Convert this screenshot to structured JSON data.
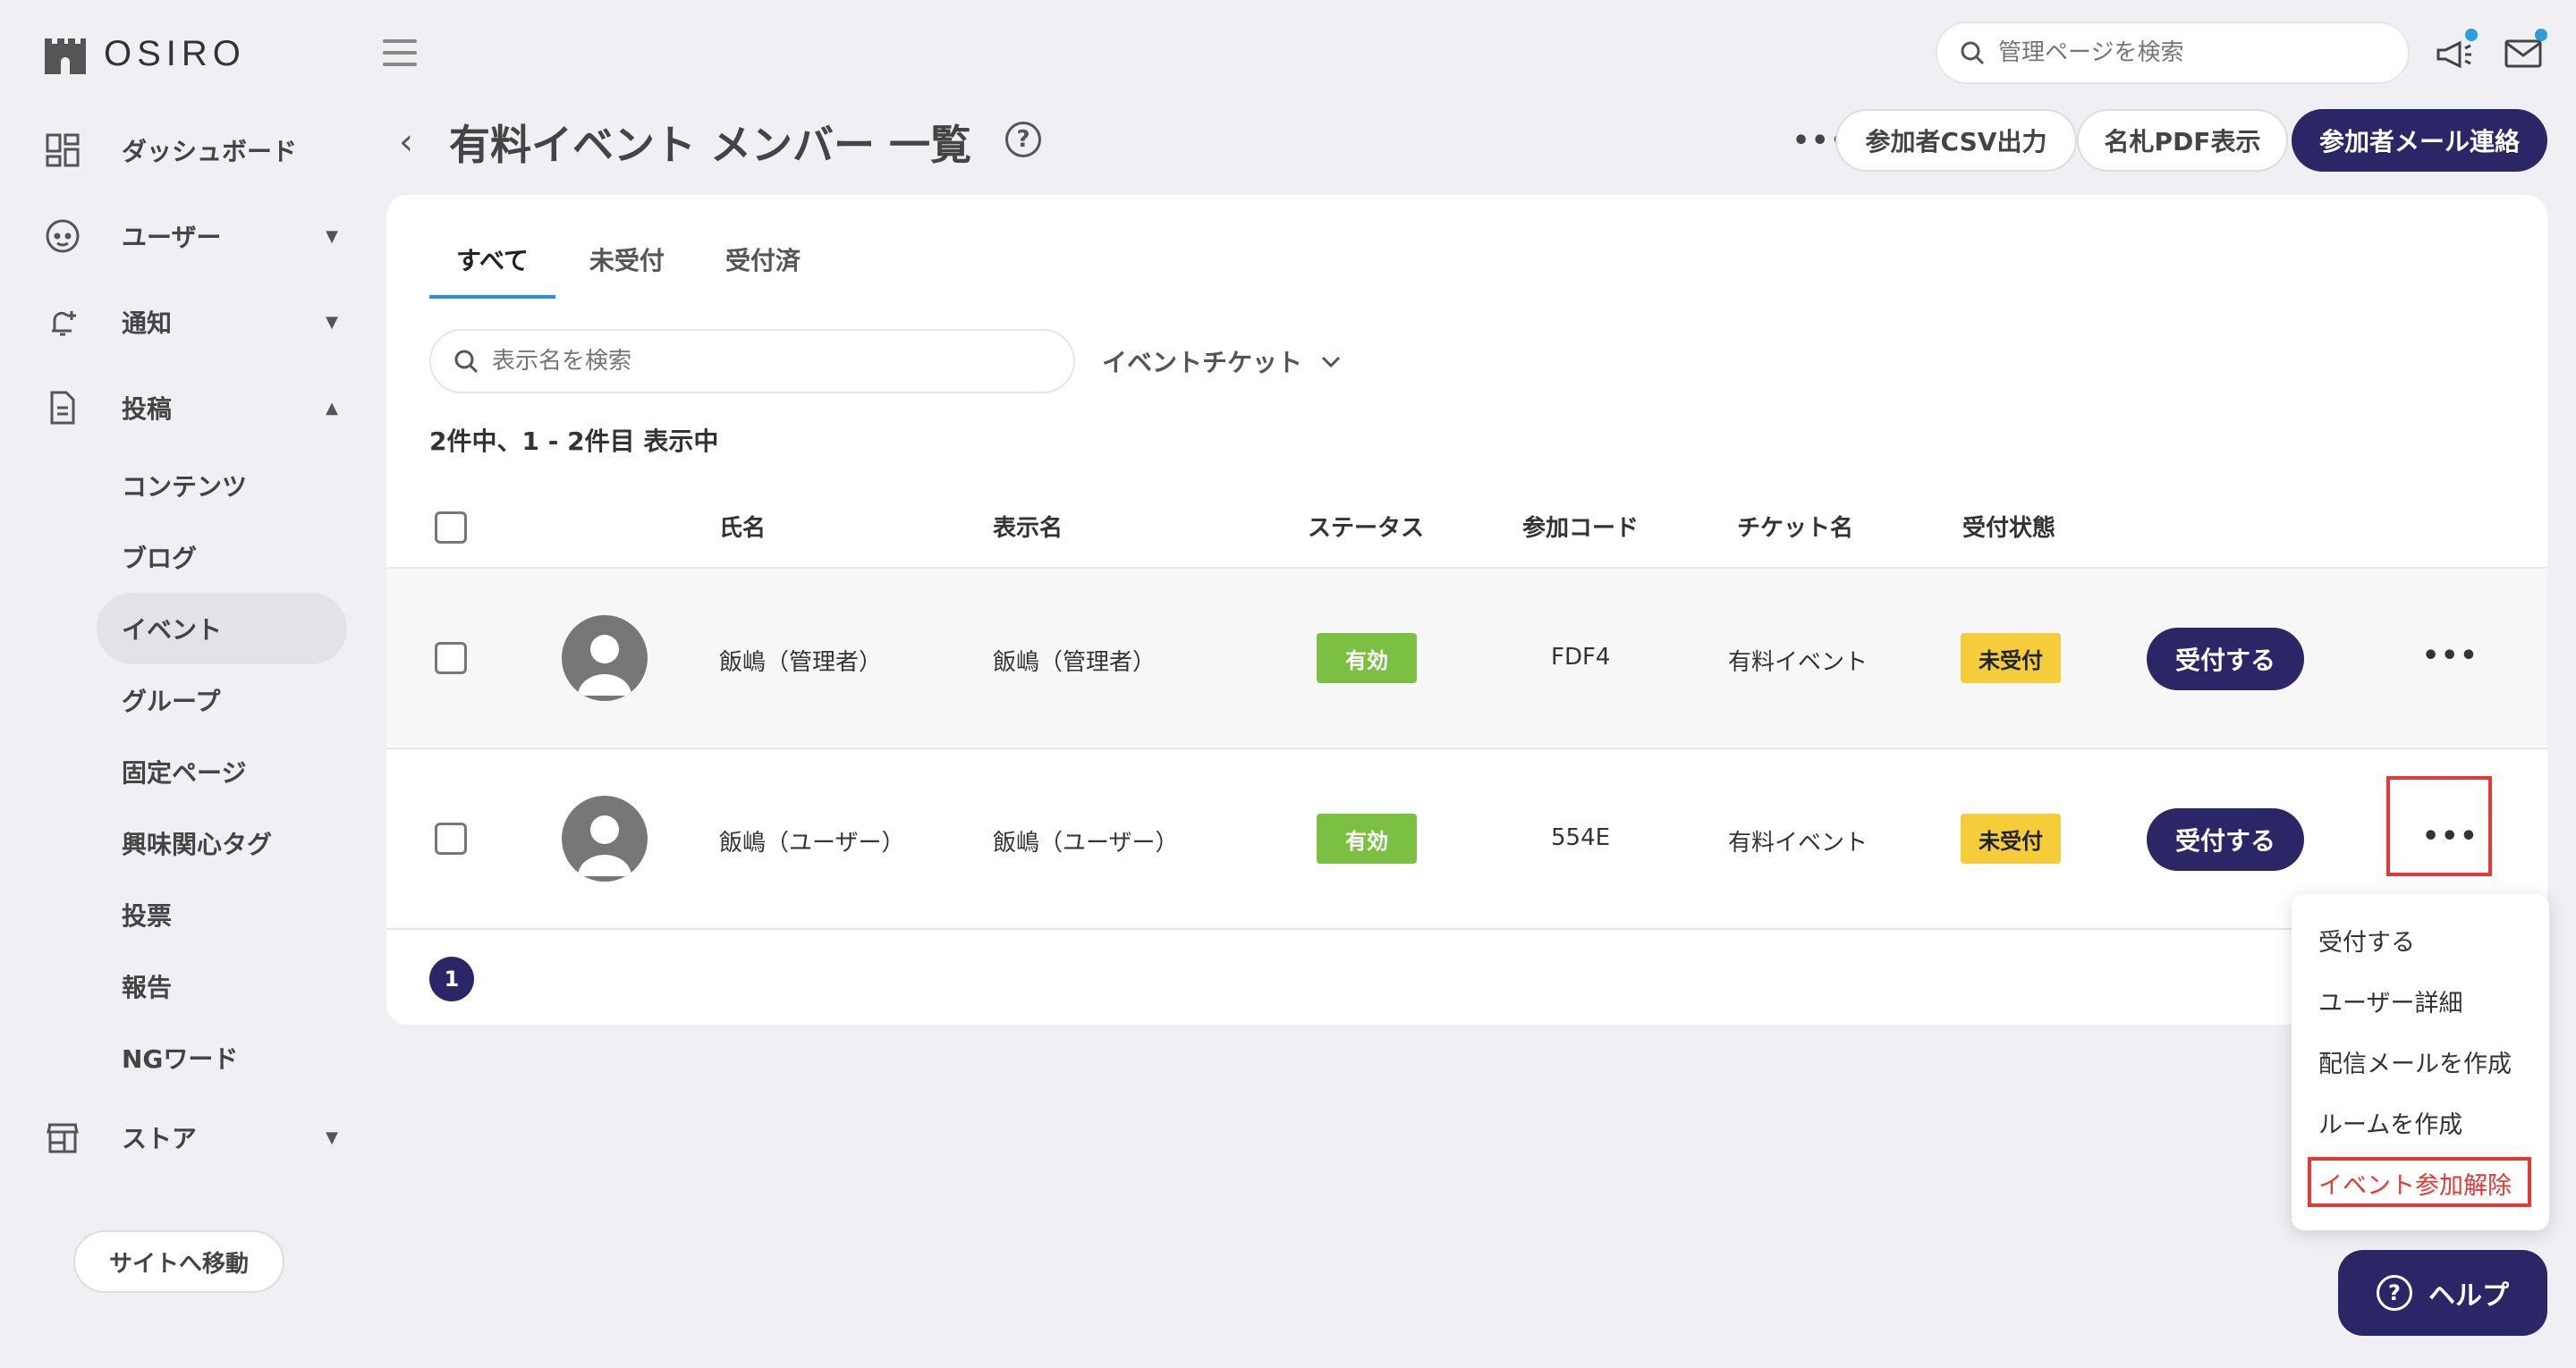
{
  "app": {
    "logo_text": "OSIRO"
  },
  "sidebar": {
    "items": [
      {
        "label": "ダッシュボード",
        "icon": "dashboard-icon"
      },
      {
        "label": "ユーザー",
        "icon": "user-face-icon",
        "caret": "▼"
      },
      {
        "label": "通知",
        "icon": "bell-plus-icon",
        "caret": "▼"
      },
      {
        "label": "投稿",
        "icon": "document-icon",
        "caret": "▲"
      },
      {
        "label": "ストア",
        "icon": "store-icon",
        "caret": "▼"
      }
    ],
    "sub_items": [
      "コンテンツ",
      "ブログ",
      "イベント",
      "グループ",
      "固定ページ",
      "興味関心タグ",
      "投票",
      "報告",
      "NGワード"
    ],
    "site_button": "サイトへ移動"
  },
  "header": {
    "search_placeholder": "管理ページを検索",
    "page_title": "有料イベント メンバー 一覧",
    "help_mark": "?",
    "more": "•••",
    "csv_button": "参加者CSV出力",
    "pdf_button": "名札PDF表示",
    "mail_button": "参加者メール連絡"
  },
  "tabs": [
    "すべて",
    "未受付",
    "受付済"
  ],
  "filters": {
    "search_placeholder": "表示名を検索",
    "ticket_filter": "イベントチケット"
  },
  "count_text": "2件中、1 - 2件目 表示中",
  "table": {
    "headers": [
      "氏名",
      "表示名",
      "ステータス",
      "参加コード",
      "チケット名",
      "受付状態"
    ],
    "rows": [
      {
        "name": "飯嶋（管理者）",
        "display": "飯嶋（管理者）",
        "status": "有効",
        "code": "FDF4",
        "ticket": "有料イベント",
        "reception": "未受付",
        "action": "受付する",
        "more": "•••"
      },
      {
        "name": "飯嶋（ユーザー）",
        "display": "飯嶋（ユーザー）",
        "status": "有効",
        "code": "554E",
        "ticket": "有料イベント",
        "reception": "未受付",
        "action": "受付する",
        "more": "•••"
      }
    ]
  },
  "pagination": {
    "current": "1"
  },
  "dropdown": {
    "items": [
      "受付する",
      "ユーザー詳細",
      "配信メールを作成",
      "ルームを作成",
      "イベント参加解除"
    ]
  },
  "help_button": {
    "label": "ヘルプ",
    "mark": "?"
  },
  "colors": {
    "primary": "#2b2665",
    "tab_underline": "#2d8cdb",
    "active_badge": "#7bc043",
    "pending_badge": "#f5cc3a",
    "danger": "#e53935"
  }
}
